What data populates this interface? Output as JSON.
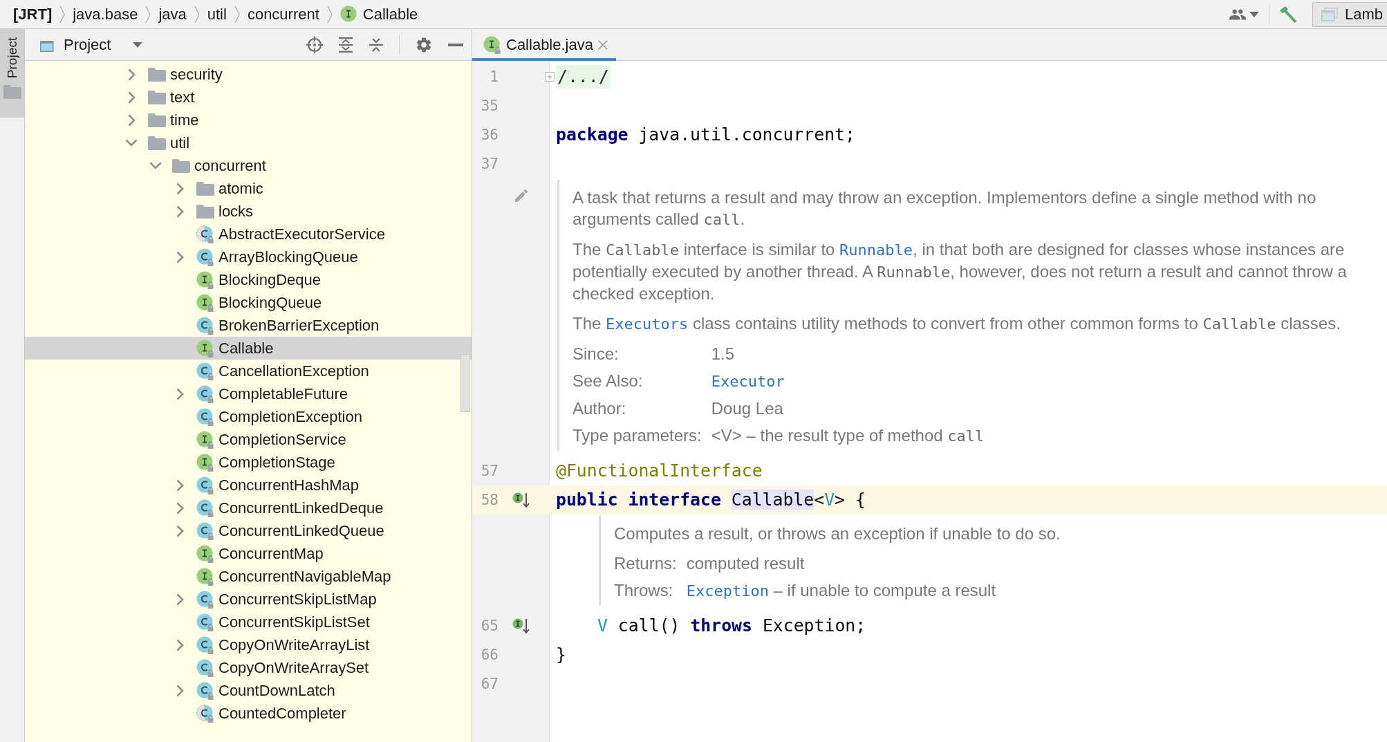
{
  "breadcrumbs": {
    "items": [
      {
        "label": "[JRT]",
        "kind": "root"
      },
      {
        "label": "java.base",
        "kind": "module"
      },
      {
        "label": "java",
        "kind": "package"
      },
      {
        "label": "util",
        "kind": "package"
      },
      {
        "label": "concurrent",
        "kind": "package"
      },
      {
        "label": "Callable",
        "kind": "interface"
      }
    ]
  },
  "toolbar": {
    "run_configuration": "Lamb"
  },
  "side_strip": {
    "tabs": [
      {
        "label": "Project",
        "selected": true
      }
    ]
  },
  "project_panel": {
    "title": "Project",
    "tree": [
      {
        "label": "security",
        "kind": "folder",
        "expanded": false,
        "selected": false
      },
      {
        "label": "text",
        "kind": "folder",
        "expanded": false,
        "selected": false
      },
      {
        "label": "time",
        "kind": "folder",
        "expanded": false,
        "selected": false
      },
      {
        "label": "util",
        "kind": "folder",
        "expanded": true,
        "selected": false,
        "children": [
          {
            "label": "concurrent",
            "kind": "folder",
            "expanded": true,
            "selected": false,
            "children": [
              {
                "label": "atomic",
                "kind": "folder",
                "expanded": false,
                "selected": false
              },
              {
                "label": "locks",
                "kind": "folder",
                "expanded": false,
                "selected": false
              },
              {
                "label": "AbstractExecutorService",
                "kind": "abstract_class",
                "selected": false
              },
              {
                "label": "ArrayBlockingQueue",
                "kind": "class",
                "expanded": false,
                "selected": false
              },
              {
                "label": "BlockingDeque",
                "kind": "interface",
                "selected": false
              },
              {
                "label": "BlockingQueue",
                "kind": "interface",
                "selected": false
              },
              {
                "label": "BrokenBarrierException",
                "kind": "class",
                "selected": false
              },
              {
                "label": "Callable",
                "kind": "interface",
                "selected": true
              },
              {
                "label": "CancellationException",
                "kind": "class",
                "selected": false
              },
              {
                "label": "CompletableFuture",
                "kind": "class",
                "expanded": false,
                "selected": false
              },
              {
                "label": "CompletionException",
                "kind": "class",
                "selected": false
              },
              {
                "label": "CompletionService",
                "kind": "interface",
                "selected": false
              },
              {
                "label": "CompletionStage",
                "kind": "interface",
                "selected": false
              },
              {
                "label": "ConcurrentHashMap",
                "kind": "class",
                "expanded": false,
                "selected": false
              },
              {
                "label": "ConcurrentLinkedDeque",
                "kind": "class",
                "expanded": false,
                "selected": false
              },
              {
                "label": "ConcurrentLinkedQueue",
                "kind": "class",
                "expanded": false,
                "selected": false
              },
              {
                "label": "ConcurrentMap",
                "kind": "interface",
                "selected": false
              },
              {
                "label": "ConcurrentNavigableMap",
                "kind": "interface",
                "selected": false
              },
              {
                "label": "ConcurrentSkipListMap",
                "kind": "class",
                "expanded": false,
                "selected": false
              },
              {
                "label": "ConcurrentSkipListSet",
                "kind": "class",
                "selected": false
              },
              {
                "label": "CopyOnWriteArrayList",
                "kind": "class",
                "expanded": false,
                "selected": false
              },
              {
                "label": "CopyOnWriteArraySet",
                "kind": "class",
                "selected": false
              },
              {
                "label": "CountDownLatch",
                "kind": "class",
                "expanded": false,
                "selected": false
              },
              {
                "label": "CountedCompleter",
                "kind": "abstract_class",
                "selected": false
              }
            ]
          }
        ]
      }
    ]
  },
  "editor": {
    "tabs": [
      {
        "label": "Callable.java",
        "kind": "interface",
        "selected": true
      }
    ],
    "lines": [
      {
        "kind": "folded",
        "number": "1",
        "text": "/.../",
        "current": false,
        "indented": false,
        "implemented": false
      },
      {
        "kind": "code",
        "number": "35",
        "current": false,
        "implemented": false
      },
      {
        "kind": "code",
        "number": "36",
        "current": false,
        "indented": false,
        "implemented": false,
        "tokens": [
          {
            "text": "package",
            "kind": "keyword"
          },
          {
            "text": " java.util.concurrent;",
            "kind": "plain"
          }
        ]
      },
      {
        "kind": "code",
        "number": "37",
        "current": false,
        "implemented": false
      },
      {
        "kind": "doc",
        "indented": false,
        "hovered": true,
        "paragraphs": [
          [
            {
              "text": "A task that returns a result and may throw an exception. Implementors define a single method with no arguments called ",
              "kind": "text"
            },
            {
              "text": "call",
              "kind": "code"
            },
            {
              "text": ".",
              "kind": "text"
            }
          ],
          [
            {
              "text": "The ",
              "kind": "text"
            },
            {
              "text": "Callable",
              "kind": "code"
            },
            {
              "text": " interface is similar to ",
              "kind": "text"
            },
            {
              "text": "Runnable",
              "kind": "link"
            },
            {
              "text": ", in that both are designed for classes whose instances are potentially executed by another thread. A ",
              "kind": "text"
            },
            {
              "text": "Runnable",
              "kind": "code"
            },
            {
              "text": ", however, does not return a result and cannot throw a checked exception.",
              "kind": "text"
            }
          ],
          [
            {
              "text": "The ",
              "kind": "text"
            },
            {
              "text": "Executors",
              "kind": "link"
            },
            {
              "text": " class contains utility methods to convert from other common forms to ",
              "kind": "text"
            },
            {
              "text": "Callable",
              "kind": "code"
            },
            {
              "text": " classes.",
              "kind": "text"
            }
          ]
        ],
        "tags": [
          {
            "label": "Since:",
            "value": [
              {
                "text": "1.5",
                "kind": "text"
              }
            ]
          },
          {
            "label": "See Also:",
            "value": [
              {
                "text": "Executor",
                "kind": "link"
              }
            ]
          },
          {
            "label": "Author:",
            "value": [
              {
                "text": "Doug Lea",
                "kind": "text"
              }
            ]
          },
          {
            "label": "Type parameters:",
            "value": [
              {
                "text": "<V> – the result type of method ",
                "kind": "text"
              },
              {
                "text": "call",
                "kind": "code"
              }
            ]
          }
        ]
      },
      {
        "kind": "code",
        "number": "57",
        "current": false,
        "indented": false,
        "implemented": false,
        "tokens": [
          {
            "text": "@FunctionalInterface",
            "kind": "annotation"
          }
        ]
      },
      {
        "kind": "code",
        "number": "58",
        "current": true,
        "indented": false,
        "implemented": true,
        "tokens": [
          {
            "text": "public interface ",
            "kind": "keyword"
          },
          {
            "text": "Callable",
            "kind": "usage"
          },
          {
            "text": "<",
            "kind": "plain"
          },
          {
            "text": "V",
            "kind": "type_param"
          },
          {
            "text": "> {",
            "kind": "plain"
          }
        ]
      },
      {
        "kind": "doc",
        "indented": true,
        "hovered": false,
        "paragraphs": [
          [
            {
              "text": "Computes a result, or throws an exception if unable to do so.",
              "kind": "text"
            }
          ]
        ],
        "tags": [
          {
            "label": "Returns:",
            "value": [
              {
                "text": "computed result",
                "kind": "text"
              }
            ]
          },
          {
            "label": "Throws:",
            "value": [
              {
                "text": "Exception",
                "kind": "link"
              },
              {
                "text": " – if unable to compute a result",
                "kind": "text"
              }
            ]
          }
        ]
      },
      {
        "kind": "code",
        "number": "65",
        "current": false,
        "indented": true,
        "implemented": true,
        "tokens": [
          {
            "text": "V",
            "kind": "type_param"
          },
          {
            "text": " call() ",
            "kind": "plain"
          },
          {
            "text": "throws",
            "kind": "keyword"
          },
          {
            "text": " Exception;",
            "kind": "plain"
          }
        ]
      },
      {
        "kind": "code",
        "number": "66",
        "current": false,
        "indented": false,
        "implemented": false,
        "tokens": [
          {
            "text": "}",
            "kind": "plain"
          }
        ]
      },
      {
        "kind": "code",
        "number": "67",
        "current": false,
        "implemented": false
      }
    ]
  }
}
